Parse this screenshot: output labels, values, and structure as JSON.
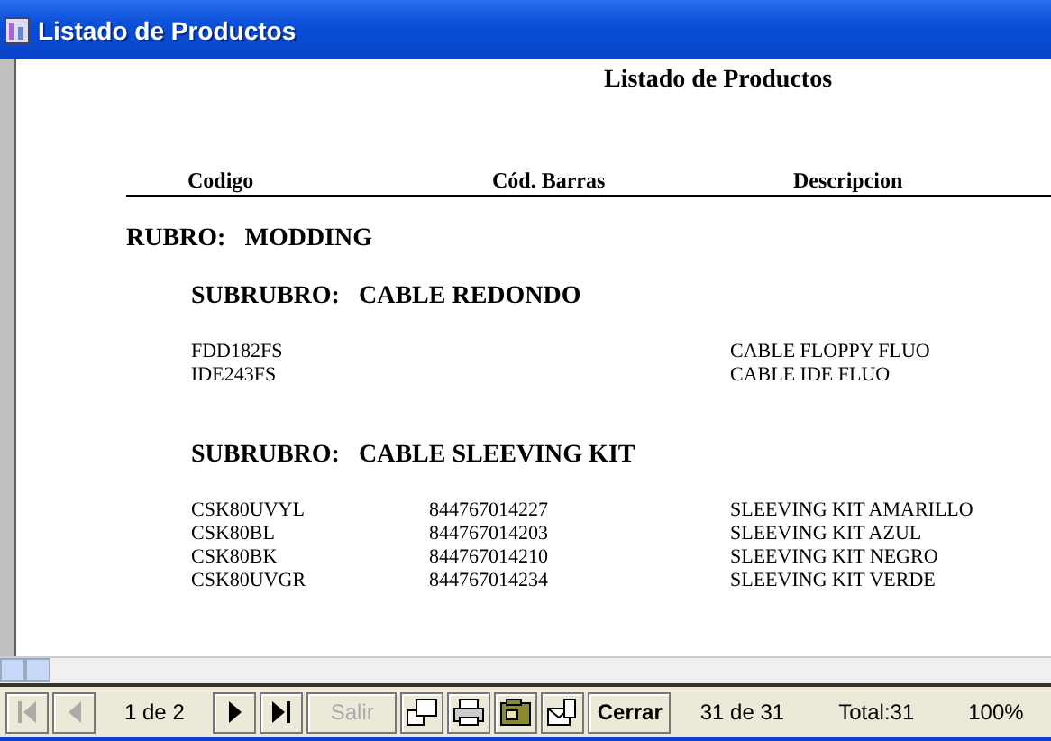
{
  "window": {
    "title": "Listado de Productos"
  },
  "report": {
    "title": "Listado de Productos",
    "columns": [
      "Codigo",
      "Cód. Barras",
      "Descripcion"
    ],
    "groups": [
      {
        "label": "RUBRO:",
        "name": "MODDING",
        "subgroups": [
          {
            "label": "SUBRUBRO:",
            "name": "CABLE REDONDO",
            "rows": [
              {
                "code": "FDD182FS",
                "description": "CABLE FLOPPY FLUO"
              },
              {
                "code": "IDE243FS",
                "description": "CABLE IDE FLUO"
              }
            ]
          },
          {
            "label": "SUBRUBRO:",
            "name": "CABLE SLEEVING KIT",
            "rows": [
              {
                "code": "CSK80UVYL",
                "barcode": "844767014227",
                "description": "SLEEVING KIT AMARILLO"
              },
              {
                "code": "CSK80BL",
                "barcode": "844767014203",
                "description": "SLEEVING KIT AZUL"
              },
              {
                "code": "CSK80BK",
                "barcode": "844767014210",
                "description": "SLEEVING KIT NEGRO"
              },
              {
                "code": "CSK80UVGR",
                "barcode": "844767014234",
                "description": "SLEEVING KIT VERDE"
              }
            ]
          }
        ]
      }
    ]
  },
  "toolbar": {
    "items": [
      {
        "kind": "first",
        "disabled": true
      },
      {
        "kind": "previous",
        "disabled": true
      },
      {
        "kind": "label",
        "text": "1 de 2"
      },
      {
        "kind": "next",
        "disabled": false
      },
      {
        "kind": "last",
        "disabled": false
      },
      {
        "kind": "button",
        "text": "Salir",
        "disabled": true
      },
      {
        "kind": "pages",
        "disabled": false
      },
      {
        "kind": "print",
        "disabled": false
      },
      {
        "kind": "export",
        "disabled": false
      },
      {
        "kind": "mail",
        "disabled": false
      },
      {
        "kind": "button",
        "text": "Cerrar",
        "disabled": false
      },
      {
        "kind": "label",
        "text": "31 de 31"
      },
      {
        "kind": "label",
        "text": "Total:31"
      },
      {
        "kind": "label",
        "text": "100%"
      }
    ]
  }
}
